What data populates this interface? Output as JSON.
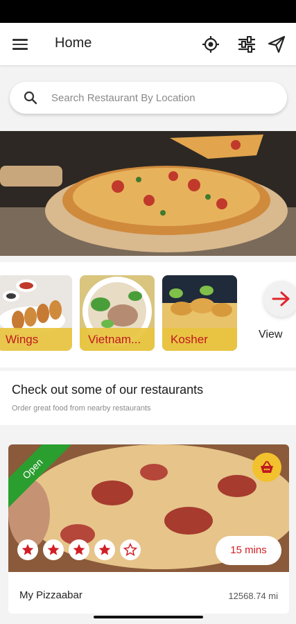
{
  "header": {
    "title": "Home"
  },
  "search": {
    "placeholder": "Search Restaurant By Location"
  },
  "categories": [
    {
      "label": "Wings"
    },
    {
      "label": "Vietnam..."
    },
    {
      "label": "Kosher"
    }
  ],
  "view_more": {
    "label": "View"
  },
  "section": {
    "title": "Check out some of our restaurants",
    "subtitle": "Order great food from nearby restaurants"
  },
  "restaurant": {
    "status": "Open",
    "rating": 4,
    "rating_max": 5,
    "delivery_time": "15 mins",
    "name": "My Pizzaabar",
    "distance": "12568.74 mi"
  },
  "colors": {
    "accent_red": "#d11f26",
    "accent_yellow": "#f2c12e",
    "open_green": "#2a9e2f"
  },
  "banner": {
    "slide_count": 3,
    "active_slide": 1
  }
}
